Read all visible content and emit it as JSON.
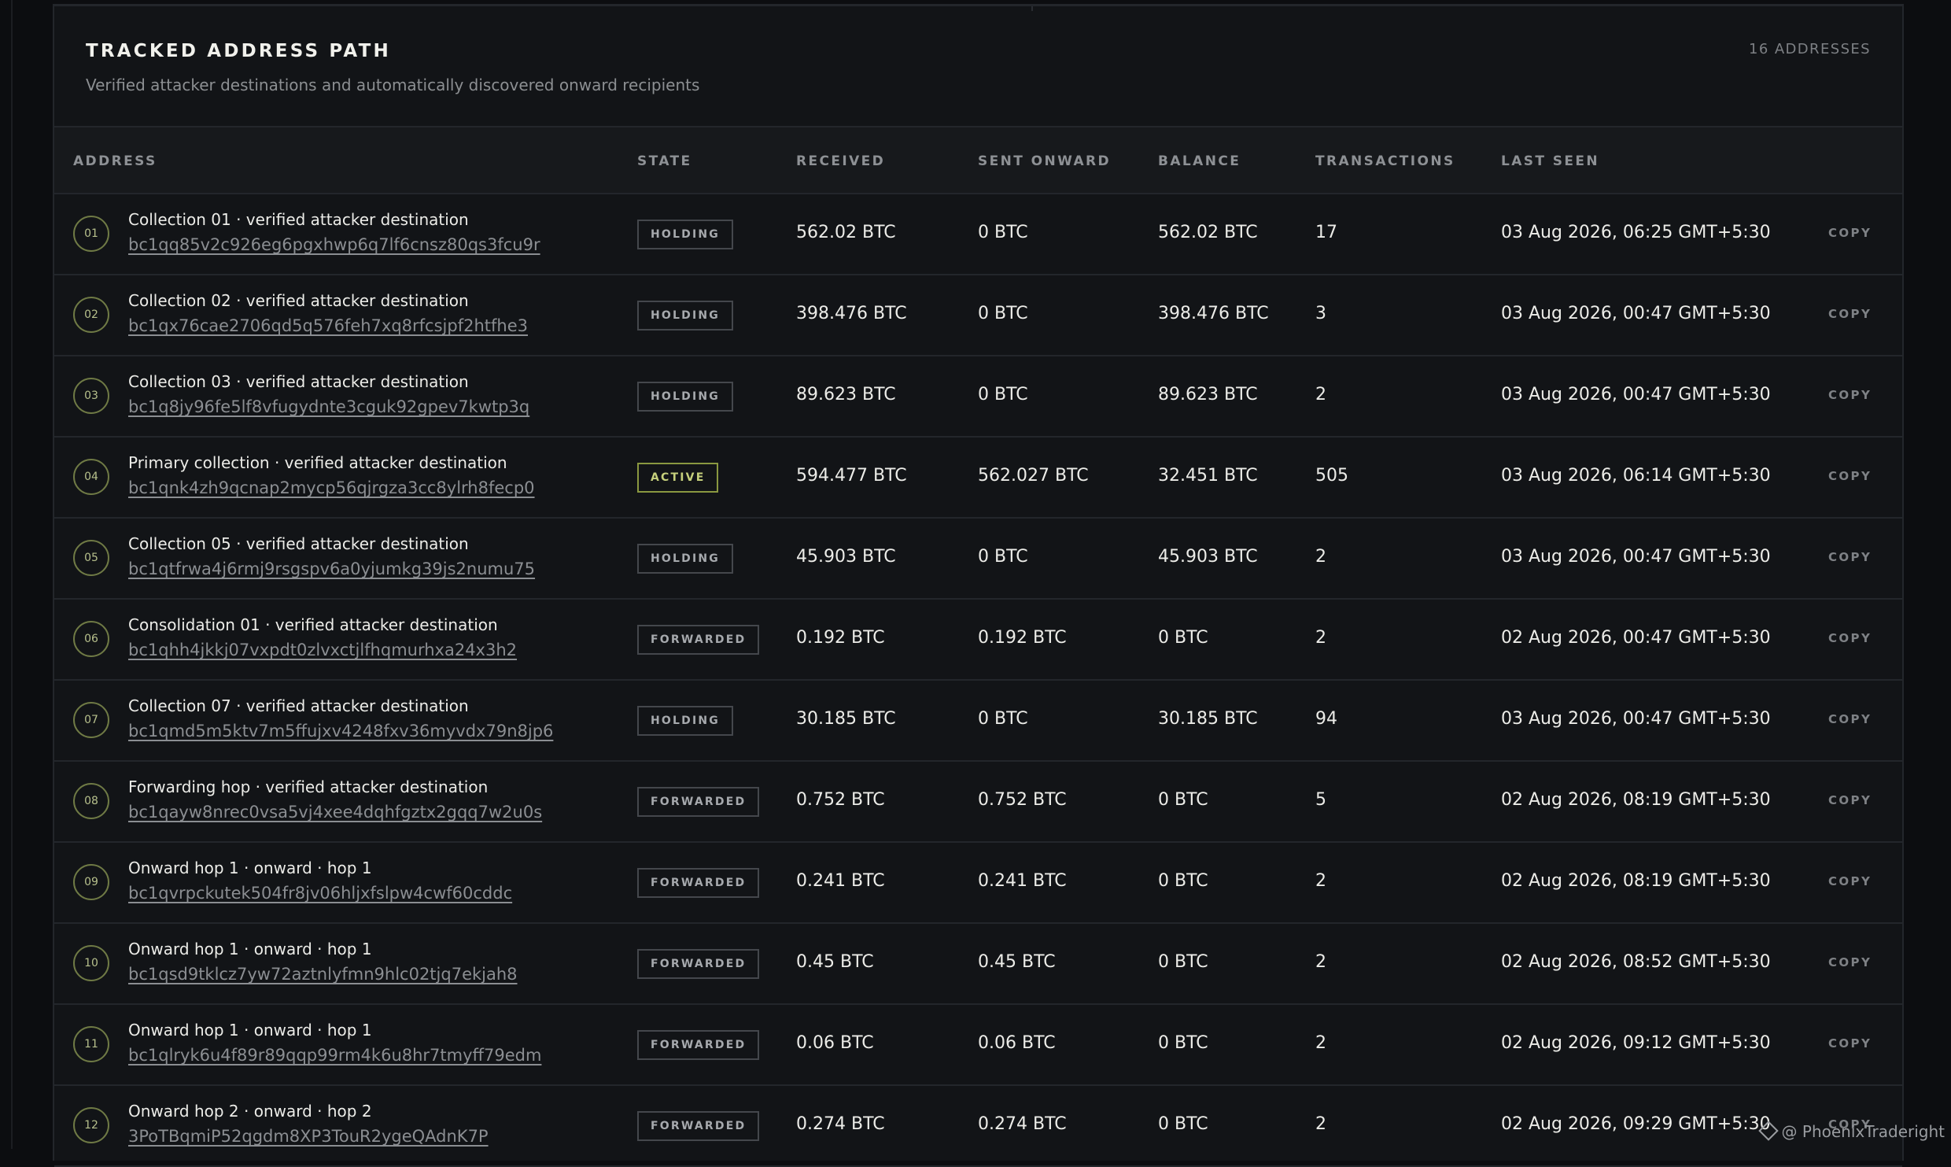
{
  "header": {
    "title": "TRACKED ADDRESS PATH",
    "subtitle": "Verified attacker destinations and automatically discovered onward recipients",
    "count": "16 ADDRESSES"
  },
  "columns": {
    "address": "ADDRESS",
    "state": "STATE",
    "received": "RECEIVED",
    "sent": "SENT ONWARD",
    "balance": "BALANCE",
    "transactions": "TRANSACTIONS",
    "last_seen": "LAST SEEN"
  },
  "rows": [
    {
      "idx": "01",
      "label": "Collection 01 · verified attacker destination",
      "address": "bc1qq85v2c926eg6pgxhwp6q7lf6cnsz80qs3fcu9r",
      "state": "HOLDING",
      "received": "562.02 BTC",
      "sent": "0 BTC",
      "balance": "562.02 BTC",
      "tx": "17",
      "last_seen": "03 Aug 2026, 06:25 GMT+5:30",
      "copy": "COPY"
    },
    {
      "idx": "02",
      "label": "Collection 02 · verified attacker destination",
      "address": "bc1qx76cae2706qd5q576feh7xq8rfcsjpf2htfhe3",
      "state": "HOLDING",
      "received": "398.476 BTC",
      "sent": "0 BTC",
      "balance": "398.476 BTC",
      "tx": "3",
      "last_seen": "03 Aug 2026, 00:47 GMT+5:30",
      "copy": "COPY"
    },
    {
      "idx": "03",
      "label": "Collection 03 · verified attacker destination",
      "address": "bc1q8jy96fe5lf8vfugydnte3cguk92gpev7kwtp3q",
      "state": "HOLDING",
      "received": "89.623 BTC",
      "sent": "0 BTC",
      "balance": "89.623 BTC",
      "tx": "2",
      "last_seen": "03 Aug 2026, 00:47 GMT+5:30",
      "copy": "COPY"
    },
    {
      "idx": "04",
      "label": "Primary collection · verified attacker destination",
      "address": "bc1qnk4zh9qcnap2mycp56qjrgza3cc8ylrh8fecp0",
      "state": "ACTIVE",
      "received": "594.477 BTC",
      "sent": "562.027 BTC",
      "balance": "32.451 BTC",
      "tx": "505",
      "last_seen": "03 Aug 2026, 06:14 GMT+5:30",
      "copy": "COPY"
    },
    {
      "idx": "05",
      "label": "Collection 05 · verified attacker destination",
      "address": "bc1qtfrwa4j6rmj9rsgspv6a0yjumkg39js2numu75",
      "state": "HOLDING",
      "received": "45.903 BTC",
      "sent": "0 BTC",
      "balance": "45.903 BTC",
      "tx": "2",
      "last_seen": "03 Aug 2026, 00:47 GMT+5:30",
      "copy": "COPY"
    },
    {
      "idx": "06",
      "label": "Consolidation 01 · verified attacker destination",
      "address": "bc1qhh4jkkj07vxpdt0zlvxctjlfhqmurhxa24x3h2",
      "state": "FORWARDED",
      "received": "0.192 BTC",
      "sent": "0.192 BTC",
      "balance": "0 BTC",
      "tx": "2",
      "last_seen": "02 Aug 2026, 00:47 GMT+5:30",
      "copy": "COPY"
    },
    {
      "idx": "07",
      "label": "Collection 07 · verified attacker destination",
      "address": "bc1qmd5m5ktv7m5ffujxv4248fxv36myvdx79n8jp6",
      "state": "HOLDING",
      "received": "30.185 BTC",
      "sent": "0 BTC",
      "balance": "30.185 BTC",
      "tx": "94",
      "last_seen": "03 Aug 2026, 00:47 GMT+5:30",
      "copy": "COPY"
    },
    {
      "idx": "08",
      "label": "Forwarding hop · verified attacker destination",
      "address": "bc1qayw8nrec0vsa5vj4xee4dqhfgztx2gqq7w2u0s",
      "state": "FORWARDED",
      "received": "0.752 BTC",
      "sent": "0.752 BTC",
      "balance": "0 BTC",
      "tx": "5",
      "last_seen": "02 Aug 2026, 08:19 GMT+5:30",
      "copy": "COPY"
    },
    {
      "idx": "09",
      "label": "Onward hop 1 · onward · hop 1",
      "address": "bc1qvrpckutek504fr8jv06hljxfslpw4cwf60cddc",
      "state": "FORWARDED",
      "received": "0.241 BTC",
      "sent": "0.241 BTC",
      "balance": "0 BTC",
      "tx": "2",
      "last_seen": "02 Aug 2026, 08:19 GMT+5:30",
      "copy": "COPY"
    },
    {
      "idx": "10",
      "label": "Onward hop 1 · onward · hop 1",
      "address": "bc1qsd9tklcz7yw72aztnlyfmn9hlc02tjq7ekjah8",
      "state": "FORWARDED",
      "received": "0.45 BTC",
      "sent": "0.45 BTC",
      "balance": "0 BTC",
      "tx": "2",
      "last_seen": "02 Aug 2026, 08:52 GMT+5:30",
      "copy": "COPY"
    },
    {
      "idx": "11",
      "label": "Onward hop 1 · onward · hop 1",
      "address": "bc1qlryk6u4f89r89qqp99rm4k6u8hr7tmyff79edm",
      "state": "FORWARDED",
      "received": "0.06 BTC",
      "sent": "0.06 BTC",
      "balance": "0 BTC",
      "tx": "2",
      "last_seen": "02 Aug 2026, 09:12 GMT+5:30",
      "copy": "COPY"
    },
    {
      "idx": "12",
      "label": "Onward hop 2 · onward · hop 2",
      "address": "3PoTBqmiP52qgdm8XP3TouR2ygeQAdnK7P",
      "state": "FORWARDED",
      "received": "0.274 BTC",
      "sent": "0.274 BTC",
      "balance": "0 BTC",
      "tx": "2",
      "last_seen": "02 Aug 2026, 09:29 GMT+5:30",
      "copy": "COPY"
    }
  ],
  "watermark": "@ PhoenixTraderight",
  "icons": {
    "index": "circle-badge",
    "watermark": "diamond-icon"
  },
  "colors": {
    "background": "#0c0d10",
    "panel": "#121417",
    "accent": "#8a9840",
    "border": "#23262b"
  }
}
